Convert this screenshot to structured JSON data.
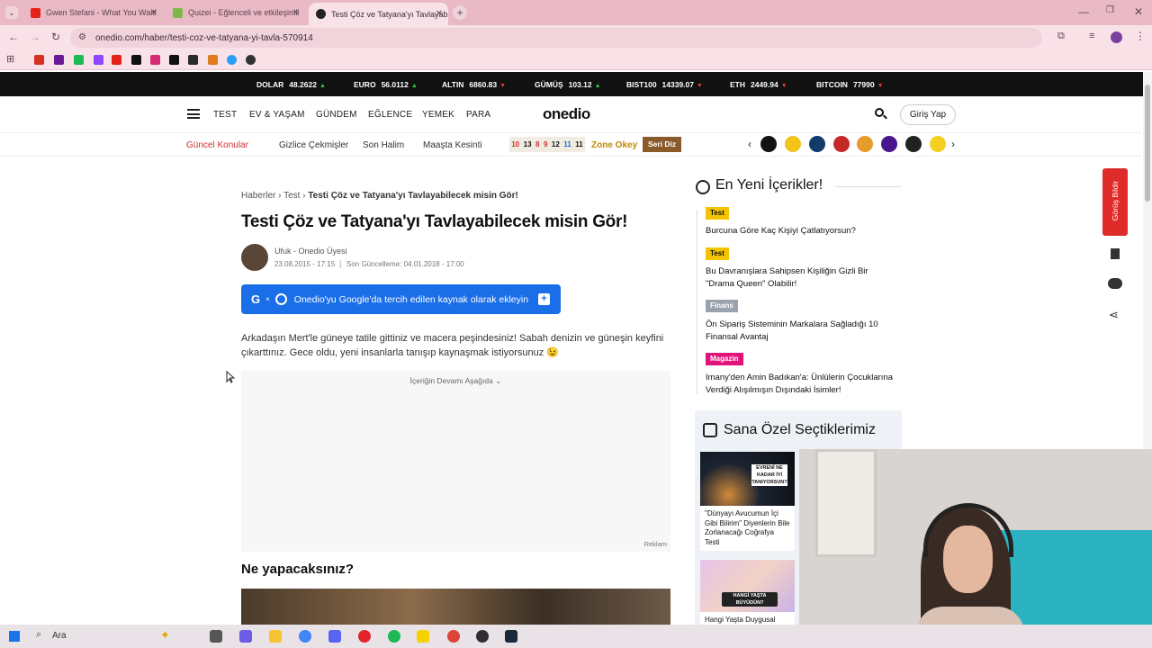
{
  "browser": {
    "tabs": [
      {
        "label": "Gwen Stefani - What You Waiti",
        "active": false
      },
      {
        "label": "Quizei - Eğlenceli ve etkileşimli",
        "active": false
      },
      {
        "label": "Testi Çöz ve Tatyana'yı Tavlayab",
        "active": true
      }
    ],
    "url": "onedio.com/haber/testi-coz-ve-tatyana-yi-tavla-570914"
  },
  "ticker": [
    {
      "name": "DOLAR",
      "value": "48.2622",
      "dir": "up"
    },
    {
      "name": "EURO",
      "value": "56.0112",
      "dir": "up"
    },
    {
      "name": "ALTIN",
      "value": "6860.83",
      "dir": "down"
    },
    {
      "name": "GÜMÜŞ",
      "value": "103.12",
      "dir": "up"
    },
    {
      "name": "BIST100",
      "value": "14339.07",
      "dir": "down"
    },
    {
      "name": "ETH",
      "value": "2449.94",
      "dir": "down"
    },
    {
      "name": "BITCOIN",
      "value": "77990",
      "dir": "down"
    }
  ],
  "header": {
    "nav": [
      "TEST",
      "EV & YAŞAM",
      "GÜNDEM",
      "EĞLENCE",
      "YEMEK",
      "PARA"
    ],
    "logo": "onedio",
    "login": "Giriş Yap"
  },
  "subnav": {
    "label": "Güncel Konular",
    "items": [
      "Gizlice Çekmişler",
      "Son Halim",
      "Maaşta Kesinti"
    ],
    "numbers": [
      "10",
      "13",
      "8",
      "9",
      "12",
      "11",
      "11"
    ],
    "zone": "Zone Okey",
    "series": "Seri Diz"
  },
  "article": {
    "breadcrumb": [
      "Haberler",
      "Test",
      "Testi Çöz ve Tatyana'yı Tavlayabilecek misin Gör!"
    ],
    "title": "Testi Çöz ve Tatyana'yı Tavlayabilecek misin Gör!",
    "author": "Ufuk - Onedio Üyesi",
    "date": "23.08.2015 - 17:15",
    "updated": "Son Güncelleme: 04.01.2018 - 17:00",
    "google_button": "Onedio'yu Google'da tercih edilen kaynak olarak ekleyin",
    "intro": "Arkadaşın Mert'le güneye tatile gittiniz ve macera peşindesiniz! Sabah denizin ve güneşin keyfini çıkarttınız. Gece oldu, yeni insanlarla tanışıp kaynaşmak istiyorsunuz 😉",
    "ad_label": "İçeriğin Devamı Aşağıda",
    "ad_tag": "Reklam",
    "question": "Ne yapacaksınız?"
  },
  "sidebar": {
    "title": "En Yeni İçerikler!",
    "items": [
      {
        "tag": "Test",
        "color": "#f5c400",
        "title": "Burcuna Göre Kaç Kişiyi Çatlatıyorsun?"
      },
      {
        "tag": "Test",
        "color": "#f5c400",
        "title": "Bu Davranışlara Sahipsen Kişiliğin Gizli Bir \"Drama Queen\" Olabilir!"
      },
      {
        "tag": "Finans",
        "color": "#9aa3ad",
        "title": "Ön Sipariş Sisteminin Markalara Sağladığı 10 Finansal Avantaj"
      },
      {
        "tag": "Magazin",
        "color": "#e0147a",
        "title": "Imany'den Amin Badıkan'a: Ünlülerin Çocuklarına Verdiği Alışılmışın Dışındaki İsimler!"
      }
    ],
    "picks_title": "Sana Özel Seçtiklerimiz",
    "cards": [
      {
        "overlay": "EVRENİ NE KADAR İYİ TANIYORSUN?",
        "title": "\"Dünyayı Avucumun İçi Gibi Bilirim\" Diyenlerin Bile Zorlanacağı Coğrafya Testi"
      },
      {
        "overlay": "HANGİ YAŞTA BÜYÜDÜN?",
        "title": "Hangi Yaşta Duygusal"
      }
    ]
  },
  "feedback": "Görüş Bildir",
  "taskbar": {
    "search": "Ara"
  }
}
